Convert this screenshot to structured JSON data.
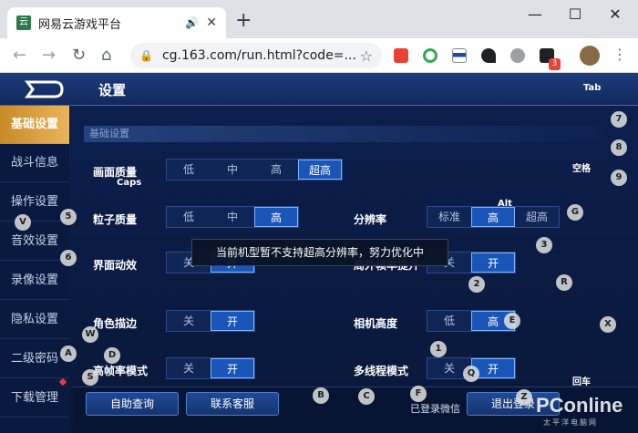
{
  "browser": {
    "tab_title": "网易云游戏平台",
    "tab_favicon": "云",
    "url": "cg.163.com/run.html?code=...",
    "extension_badge": "3"
  },
  "game": {
    "title": "设置",
    "tab_key": "Tab",
    "sidebar": [
      {
        "label": "基础设置",
        "active": true
      },
      {
        "label": "战斗信息",
        "active": false
      },
      {
        "label": "操作设置",
        "active": false
      },
      {
        "label": "音效设置",
        "active": false
      },
      {
        "label": "录像设置",
        "active": false
      },
      {
        "label": "隐私设置",
        "active": false
      },
      {
        "label": "二级密码",
        "active": false
      },
      {
        "label": "下载管理",
        "active": false
      }
    ],
    "section": "基础设置",
    "settings": {
      "quality": {
        "label": "画面质量",
        "options": [
          "低",
          "中",
          "高",
          "超高"
        ],
        "selected": "超高"
      },
      "particle": {
        "label": "粒子质量",
        "options": [
          "低",
          "中",
          "高"
        ],
        "selected": "高"
      },
      "resolution": {
        "label": "分辨率",
        "options": [
          "标准",
          "高",
          "超高"
        ],
        "selected": "高"
      },
      "ui_anim": {
        "label": "界面动效",
        "options": [
          "关",
          "开"
        ],
        "selected": "开"
      },
      "hidden_right": {
        "label": "局外帧率提升",
        "options": [
          "关",
          "开"
        ],
        "selected": "开"
      },
      "outline": {
        "label": "角色描边",
        "options": [
          "关",
          "开"
        ],
        "selected": "开"
      },
      "camera": {
        "label": "相机高度",
        "options": [
          "低",
          "高"
        ],
        "selected": "高"
      },
      "hifps": {
        "label": "高帧率模式",
        "options": [
          "关",
          "开"
        ],
        "selected": "开"
      },
      "multithread": {
        "label": "多线程模式",
        "options": [
          "关",
          "开"
        ],
        "selected": "开"
      }
    },
    "toast": "当前机型暂不支持超高分辨率，努力优化中",
    "buttons": {
      "self_help": "自助查询",
      "contact": "联系客服",
      "logout": "退出登录"
    },
    "wechat_status": "已登录微信",
    "key_hints": [
      "7",
      "8",
      "9",
      "5",
      "6",
      "V",
      "G",
      "3",
      "2",
      "R",
      "E",
      "X",
      "W",
      "A",
      "D",
      "S",
      "1",
      "Q",
      "B",
      "C",
      "F",
      "Z"
    ],
    "key_labels": {
      "caps": "Caps",
      "alt": "Alt",
      "space": "空格",
      "enter": "回车"
    }
  },
  "watermark": {
    "main": "PConline",
    "sub": "太平洋电脑网"
  }
}
